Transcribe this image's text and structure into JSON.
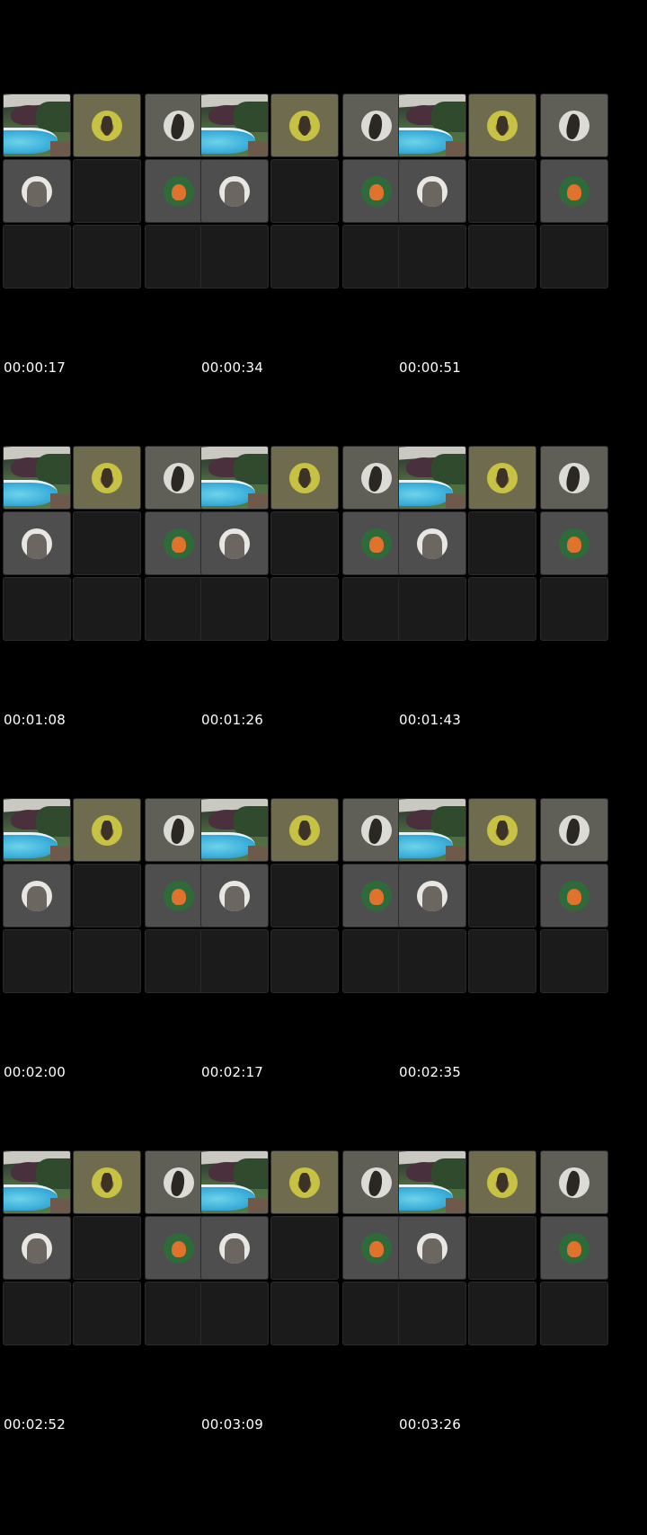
{
  "contact_sheet": {
    "frames": [
      {
        "timestamp": "00:00:17"
      },
      {
        "timestamp": "00:00:34"
      },
      {
        "timestamp": "00:00:51"
      },
      {
        "timestamp": "00:01:08"
      },
      {
        "timestamp": "00:01:26"
      },
      {
        "timestamp": "00:01:43"
      },
      {
        "timestamp": "00:02:00"
      },
      {
        "timestamp": "00:02:17"
      },
      {
        "timestamp": "00:02:35"
      },
      {
        "timestamp": "00:02:52"
      },
      {
        "timestamp": "00:03:09"
      },
      {
        "timestamp": "00:03:26"
      }
    ],
    "tiles": [
      {
        "kind": "camera-feed",
        "subject": "backyard-pool"
      },
      {
        "kind": "avatar",
        "subject": "dog-avatar"
      },
      {
        "kind": "avatar",
        "subject": "bird-avatar"
      },
      {
        "kind": "avatar",
        "subject": "cat-avatar"
      },
      {
        "kind": "empty"
      },
      {
        "kind": "avatar",
        "subject": "robin-avatar"
      },
      {
        "kind": "empty"
      },
      {
        "kind": "empty"
      },
      {
        "kind": "empty"
      }
    ]
  },
  "colors": {
    "background": "#000000",
    "tile_empty": "#1b1b1b",
    "timestamp_text": "#ffffff"
  }
}
